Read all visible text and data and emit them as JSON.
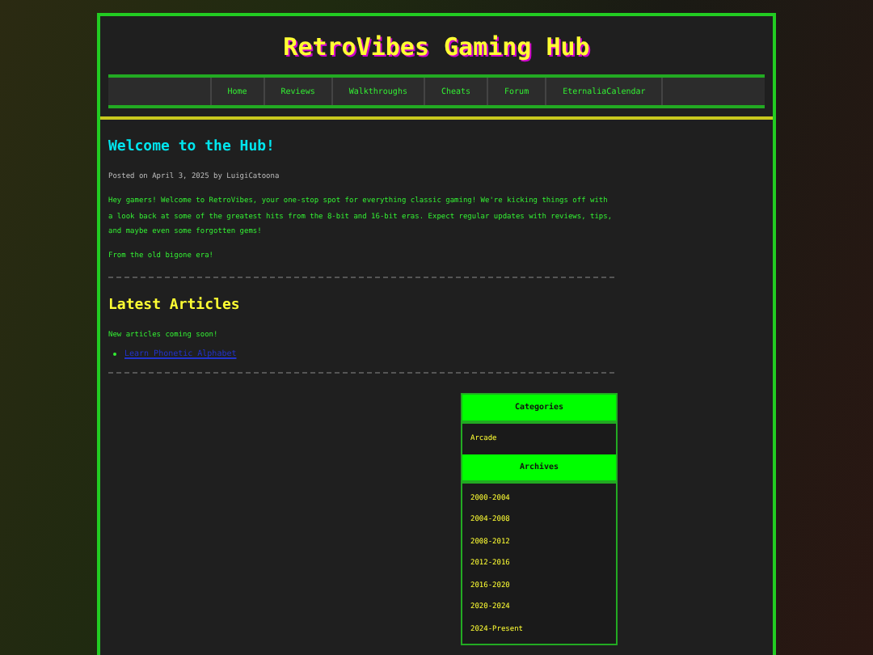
{
  "site_title": "RetroVibes Gaming Hub",
  "nav": [
    {
      "label": "Home"
    },
    {
      "label": "Reviews"
    },
    {
      "label": "Walkthroughs"
    },
    {
      "label": "Cheats"
    },
    {
      "label": "Forum"
    },
    {
      "label": "EternaliaCalendar"
    }
  ],
  "post": {
    "title": "Welcome to the Hub!",
    "meta": "Posted on April 3, 2025 by LuigiCatoona",
    "paragraphs": [
      "Hey gamers! Welcome to RetroVibes, your one-stop spot for everything classic gaming! We're kicking things off with a look back at some of the greatest hits from the 8-bit and 16-bit eras. Expect regular updates with reviews, tips, and maybe even some forgotten gems!",
      "From the old bigone era!"
    ]
  },
  "latest": {
    "title": "Latest Articles",
    "note": "New articles coming soon!",
    "links": [
      "Learn Phonetic Alphabet"
    ]
  },
  "sidebar": [
    {
      "title": "Categories",
      "items": [
        "Arcade"
      ]
    },
    {
      "title": "Archives",
      "items": [
        "2000-2004",
        "2004-2008",
        "2008-2012",
        "2012-2016",
        "2016-2020",
        "2020-2024",
        "2024-Present"
      ]
    }
  ]
}
